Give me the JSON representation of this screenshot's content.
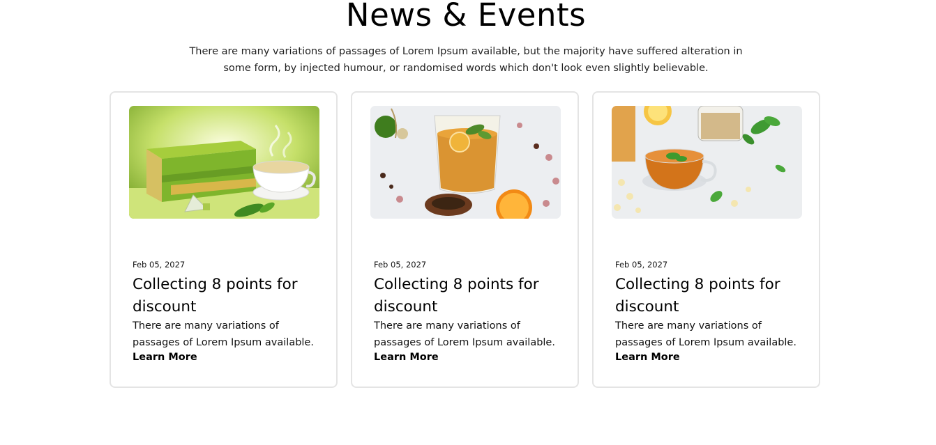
{
  "section": {
    "title": "News & Events",
    "subtitle": "There are many variations of passages of Lorem Ipsum available, but the majority have suffered alteration in some form, by injected humour, or randomised words which don't look even slightly believable."
  },
  "cards": [
    {
      "image": "green-tea-box-image",
      "date": "Feb 05, 2027",
      "title": "Collecting 8 points for discount",
      "excerpt": "There are many variations of passages of Lorem Ipsum available.",
      "link": "Learn More"
    },
    {
      "image": "tea-glass-with-orange-image",
      "date": "Feb 05, 2027",
      "title": "Collecting 8 points for discount",
      "excerpt": "There are many variations of passages of Lorem Ipsum available.",
      "link": "Learn More"
    },
    {
      "image": "herbal-tea-cup-image",
      "date": "Feb 05, 2027",
      "title": "Collecting 8 points for discount",
      "excerpt": "There are many variations of passages of Lorem Ipsum available.",
      "link": "Learn More"
    }
  ]
}
